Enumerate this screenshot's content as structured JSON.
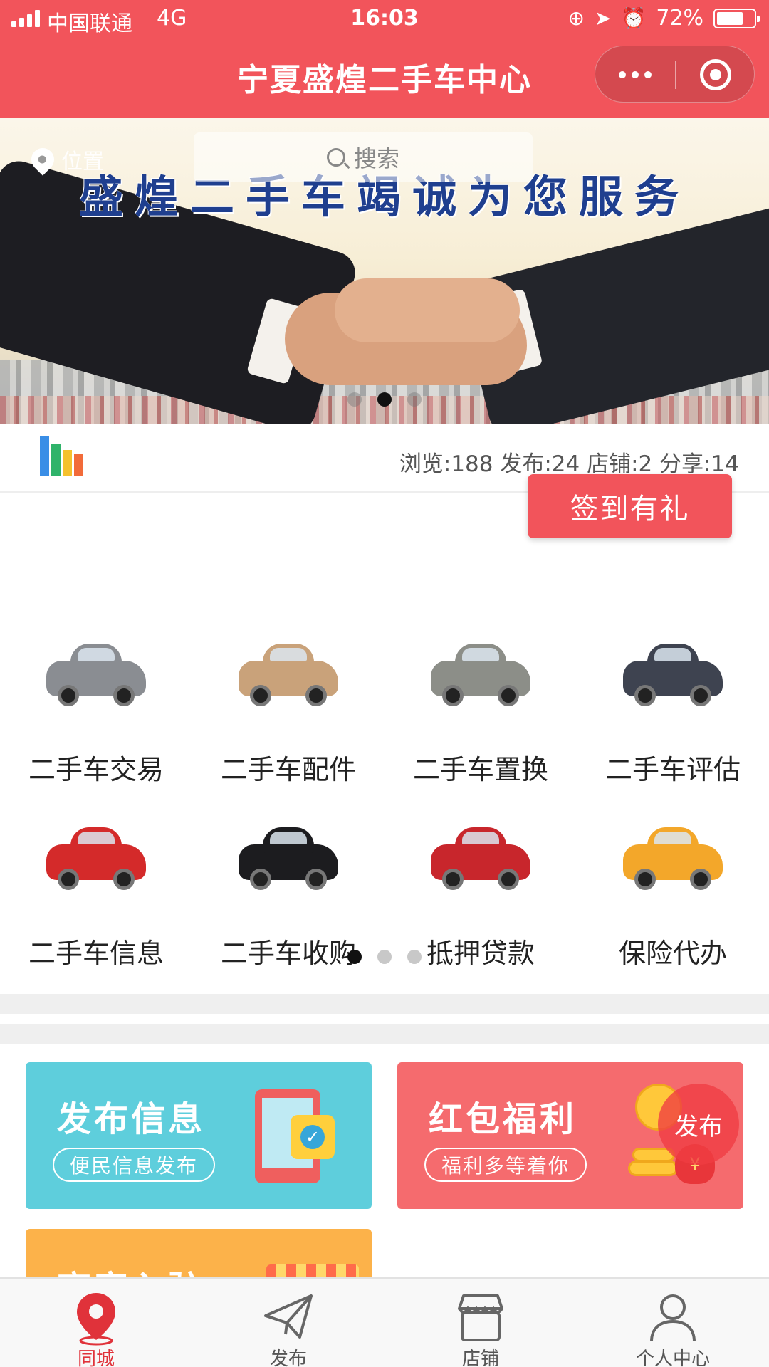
{
  "status_bar": {
    "carrier": "中国联通",
    "network": "4G",
    "time": "16:03",
    "battery_percent": "72%",
    "battery_level": 0.72
  },
  "nav": {
    "title": "宁夏盛煌二手车中心"
  },
  "banner": {
    "slogan": "盛煌二手车竭诚为您服务",
    "location_label": "位置",
    "search_placeholder": "搜索",
    "page_count": 3,
    "active_page": 2
  },
  "stats": {
    "text": "浏览:188 发布:24 店铺:2 分享:14",
    "bar_colors": [
      "#3a8ee6",
      "#2fb36a",
      "#f5c12e",
      "#f26b3a"
    ]
  },
  "checkin": {
    "label": "签到有礼"
  },
  "categories": [
    {
      "label": "二手车交易",
      "color": "#8a8d92"
    },
    {
      "label": "二手车配件",
      "color": "#c9a27a"
    },
    {
      "label": "二手车置换",
      "color": "#8c8e88"
    },
    {
      "label": "二手车评估",
      "color": "#3e4350"
    },
    {
      "label": "二手车信息",
      "color": "#d42a2a"
    },
    {
      "label": "二手车收购",
      "color": "#1c1c1f"
    },
    {
      "label": "抵押贷款",
      "color": "#c8262c"
    },
    {
      "label": "保险代办",
      "color": "#f3a72a"
    }
  ],
  "category_pager": {
    "page_count": 3,
    "active_page": 1
  },
  "promo": {
    "publish": {
      "title": "发布信息",
      "subtitle": "便民信息发布",
      "color": "#5ecedc"
    },
    "redpacket": {
      "title": "红包福利",
      "subtitle": "福利多等着你",
      "color": "#f56b6e"
    },
    "merchant": {
      "title": "商家入驻",
      "color": "#fcb24a"
    }
  },
  "fab": {
    "label": "发布"
  },
  "tabs": [
    {
      "label": "同城",
      "icon": "location-pin-icon",
      "active": true
    },
    {
      "label": "发布",
      "icon": "paper-plane-icon",
      "active": false
    },
    {
      "label": "店铺",
      "icon": "store-icon",
      "active": false
    },
    {
      "label": "个人中心",
      "icon": "user-icon",
      "active": false
    }
  ],
  "colors": {
    "brand_red": "#f2545b",
    "tab_active": "#e0323a"
  }
}
